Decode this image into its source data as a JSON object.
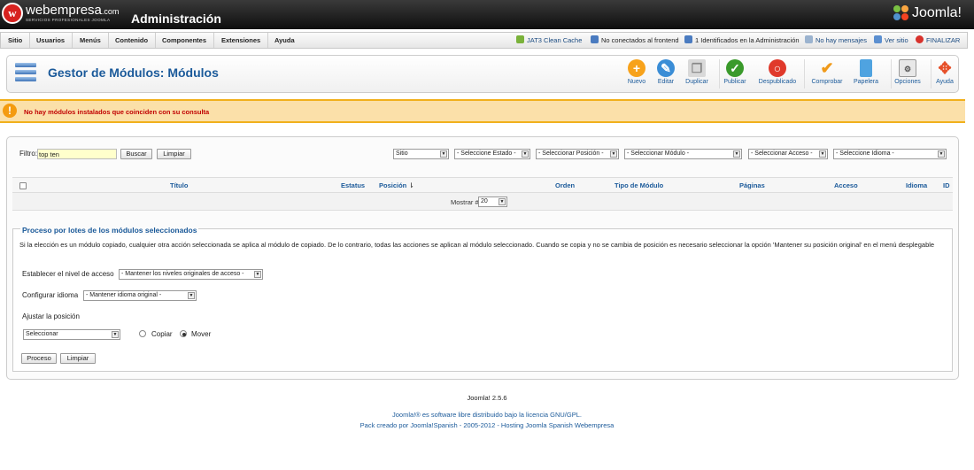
{
  "header": {
    "brand": "webempresa",
    "brand_suffix": ".com",
    "brand_sub": "SERVICIOS PROFESIONALES JOOMLA",
    "logo_letter": "w",
    "admin_title": "Administración",
    "product": "Joomla!"
  },
  "menu": {
    "items": [
      "Sitio",
      "Usuarios",
      "Menús",
      "Contenido",
      "Componentes",
      "Extensiones",
      "Ayuda"
    ]
  },
  "status": {
    "cache": "JAT3 Clean Cache",
    "frontend": "No conectados al frontend",
    "admins": "1 Identificados en la Administración",
    "messages": "No hay mensajes",
    "view_site": "Ver sitio",
    "logout": "FINALIZAR"
  },
  "toolbar": {
    "title": "Gestor de Módulos: Módulos",
    "buttons": [
      "Nuevo",
      "Editar",
      "Duplicar",
      "Publicar",
      "Despublicado",
      "Comprobar",
      "Papelera",
      "Opciones",
      "Ayuda"
    ]
  },
  "message": {
    "text": "No hay módulos instalados que coinciden con su consulta"
  },
  "filter": {
    "label": "Filtro:",
    "value": "top ten",
    "search_label": "Buscar",
    "clear_label": "Limpiar",
    "selects": [
      "Sitio",
      "- Seleccione Estado -",
      "- Seleccionar Posición -",
      "- Seleccionar Módulo -",
      "- Seleccionar Acceso -",
      "- Seleccione Idioma -"
    ]
  },
  "table": {
    "headers": [
      "Título",
      "Estatus",
      "Posición",
      "Orden",
      "Tipo de Módulo",
      "Páginas",
      "Acceso",
      "Idioma",
      "ID"
    ],
    "show_label": "Mostrar #",
    "show_value": "20"
  },
  "batch": {
    "legend": "Proceso por lotes de los módulos seleccionados",
    "description": "Si la elección es un módulo copiado, cualquier otra acción seleccionada se aplica al módulo de copiado. De lo contrario, todas las acciones se aplican al módulo seleccionado. Cuando se copia y no se cambia de posición es necesario seleccionar la opción 'Mantener su posición original' en el menú desplegable",
    "access_label": "Establecer el nivel de acceso",
    "access_value": "- Mantener los niveles originales de acceso -",
    "language_label": "Configurar idioma",
    "language_value": "- Mantener idioma original -",
    "position_label": "Ajustar la posición",
    "position_value": "Seleccionar",
    "copy_label": "Copiar",
    "move_label": "Mover",
    "process_label": "Proceso",
    "clear_label": "Limpiar"
  },
  "footer": {
    "version": "Joomla! 2.5.6",
    "license": "Joomla!® es software libre distribuido bajo la licencia GNU/GPL.",
    "pack": "Pack creado por Joomla!Spanish - 2005-2012 - Hosting Joomla Spanish Webempresa"
  },
  "colors": {
    "accent": "#1b5a9a",
    "warning_bg": "#fbe0a9",
    "warning_border": "#f1b01c",
    "error_text": "#c00000"
  }
}
